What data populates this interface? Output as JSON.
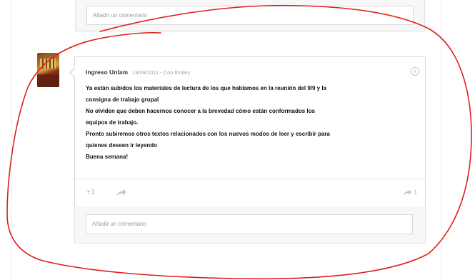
{
  "top_comment": {
    "placeholder": "Añadir un comentario"
  },
  "post": {
    "author": "Ingreso Unlam",
    "meta": "13/09/2011 - Con límites",
    "menu_icon": "circle-plus-icon",
    "body_lines": [
      "Ya están subidos los materiales de lectura de los que hablamos en la reunión del 9/9 y la",
      "consigna de trabajo grupal",
      "No olviden que deben hacernos conocer a la brevedad cómo están conformados los",
      "equipos de trabajo.",
      "Pronto subiremos otros textos relacionados con los nuevos modos de leer y escribir para",
      "quienes deseen ir leyendo",
      "Buena semana!"
    ],
    "actions": {
      "plus_one_label": "+1",
      "share_icon": "share-arrow-icon",
      "reshare_icon": "reshare-arrow-icon",
      "reshare_count": "1"
    }
  },
  "comment": {
    "placeholder": "Añadir un comentario"
  },
  "annotation": {
    "color": "#e0201a"
  }
}
